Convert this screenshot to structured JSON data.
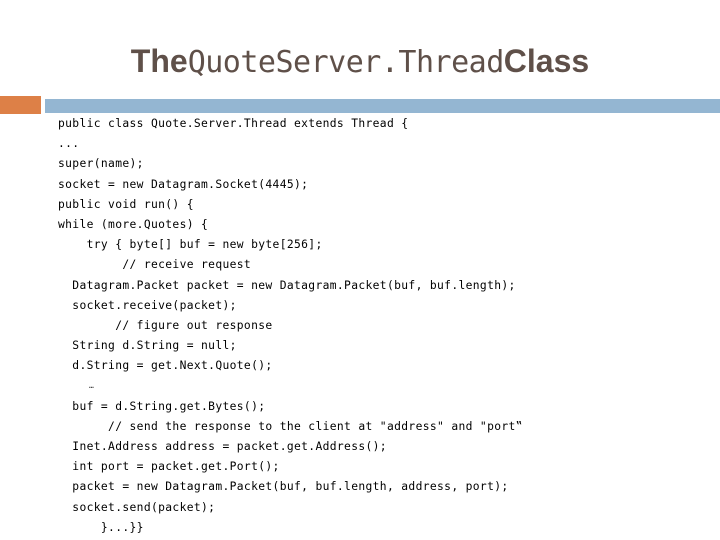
{
  "slide": {
    "title": {
      "prefix": "The",
      "mono": "QuoteServer.Thread",
      "suffix": "Class"
    },
    "colors": {
      "title_text": "#5F5049",
      "accent_orange": "#DD8047",
      "accent_blue": "#94B6D2",
      "code_text": "#000000",
      "background": "#FFFFFF"
    },
    "code": {
      "language": "java",
      "lines": [
        "public class Quote.Server.Thread extends Thread {",
        "...",
        "super(name);",
        "socket = new Datagram.Socket(4445);",
        "public void run() {",
        "while (more.Quotes) {",
        "    try { byte[] buf = new byte[256];",
        "         // receive request",
        "  Datagram.Packet packet = new Datagram.Packet(buf, buf.length);",
        "  socket.receive(packet);",
        "        // figure out response",
        "  String d.String = null;",
        "  d.String = get.Next.Quote();",
        "      …",
        "  buf = d.String.get.Bytes();",
        "       // send the response to the client at \"address\" and \"port‟",
        "  Inet.Address address = packet.get.Address();",
        "  int port = packet.get.Port();",
        "  packet = new Datagram.Packet(buf, buf.length, address, port);",
        "  socket.send(packet);",
        "      }...}}"
      ]
    }
  }
}
